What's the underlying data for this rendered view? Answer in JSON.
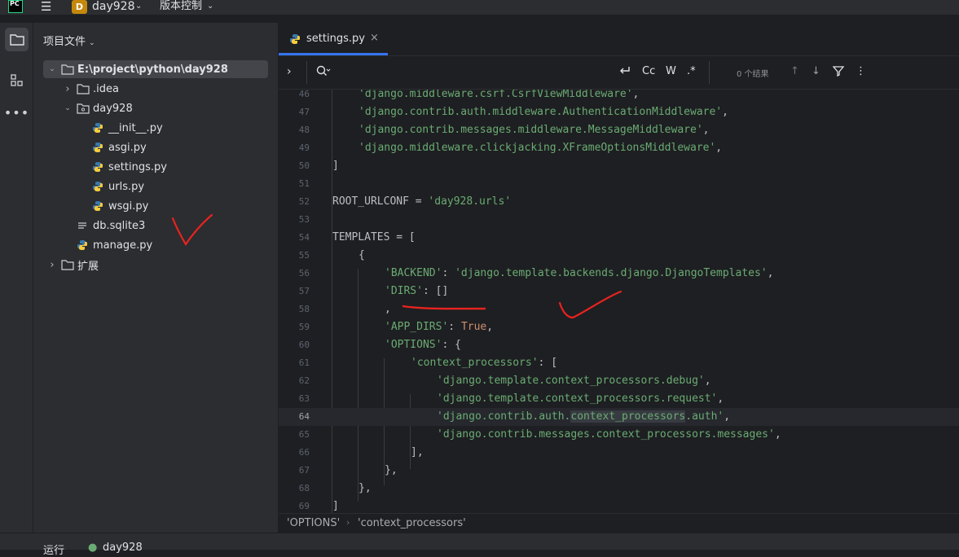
{
  "titlebar": {
    "logo_text": "PC",
    "project_badge": "D",
    "project_name": "day928",
    "vcs_label": "版本控制"
  },
  "project_panel": {
    "title": "项目文件",
    "tree": [
      {
        "label": "E:\\project\\python\\day928",
        "depth": 0,
        "arrow": "open",
        "icon": "folder-icon",
        "selected": true
      },
      {
        "label": ".idea",
        "depth": 1,
        "arrow": "closed",
        "icon": "folder-icon"
      },
      {
        "label": "day928",
        "depth": 1,
        "arrow": "open",
        "icon": "package-folder-icon"
      },
      {
        "label": "__init__.py",
        "depth": 2,
        "arrow": "none",
        "icon": "python-file-icon"
      },
      {
        "label": "asgi.py",
        "depth": 2,
        "arrow": "none",
        "icon": "python-file-icon"
      },
      {
        "label": "settings.py",
        "depth": 2,
        "arrow": "none",
        "icon": "python-file-icon"
      },
      {
        "label": "urls.py",
        "depth": 2,
        "arrow": "none",
        "icon": "python-file-icon"
      },
      {
        "label": "wsgi.py",
        "depth": 2,
        "arrow": "none",
        "icon": "python-file-icon"
      },
      {
        "label": "db.sqlite3",
        "depth": 1,
        "arrow": "none",
        "icon": "text-file-icon"
      },
      {
        "label": "manage.py",
        "depth": 1,
        "arrow": "none",
        "icon": "python-file-icon"
      },
      {
        "label": "扩展",
        "depth": 0,
        "arrow": "closed",
        "icon": "folder-icon"
      }
    ]
  },
  "editor": {
    "tab": {
      "label": "settings.py"
    },
    "find": {
      "results": "0 个结果",
      "case_label": "Cc",
      "word_label": "W",
      "regex_label": ".*"
    },
    "current_line": 64,
    "lines": [
      {
        "num": "46",
        "indent": 8,
        "tokens": [
          {
            "t": "'django.middleware.csrf.CsrfViewMiddleware'",
            "c": "s"
          },
          {
            "t": ",",
            "c": ""
          }
        ]
      },
      {
        "num": "47",
        "indent": 8,
        "tokens": [
          {
            "t": "'django.contrib.auth.middleware.AuthenticationMiddleware'",
            "c": "s"
          },
          {
            "t": ",",
            "c": ""
          }
        ]
      },
      {
        "num": "48",
        "indent": 8,
        "tokens": [
          {
            "t": "'django.contrib.messages.middleware.MessageMiddleware'",
            "c": "s"
          },
          {
            "t": ",",
            "c": ""
          }
        ]
      },
      {
        "num": "49",
        "indent": 8,
        "tokens": [
          {
            "t": "'django.middleware.clickjacking.XFrameOptionsMiddleware'",
            "c": "s"
          },
          {
            "t": ",",
            "c": ""
          }
        ]
      },
      {
        "num": "50",
        "indent": 0,
        "tokens": [
          {
            "t": "]",
            "c": ""
          }
        ]
      },
      {
        "num": "51",
        "indent": 0,
        "tokens": []
      },
      {
        "num": "52",
        "indent": 0,
        "tokens": [
          {
            "t": "ROOT_URLCONF = ",
            "c": ""
          },
          {
            "t": "'day928.urls'",
            "c": "s"
          }
        ]
      },
      {
        "num": "53",
        "indent": 0,
        "tokens": []
      },
      {
        "num": "54",
        "indent": 0,
        "tokens": [
          {
            "t": "TEMPLATES = [",
            "c": ""
          }
        ]
      },
      {
        "num": "55",
        "indent": 8,
        "tokens": [
          {
            "t": "{",
            "c": ""
          }
        ]
      },
      {
        "num": "56",
        "indent": 16,
        "tokens": [
          {
            "t": "'BACKEND'",
            "c": "s"
          },
          {
            "t": ": ",
            "c": ""
          },
          {
            "t": "'django.template.backends.django.DjangoTemplates'",
            "c": "s"
          },
          {
            "t": ",",
            "c": ""
          }
        ]
      },
      {
        "num": "57",
        "indent": 16,
        "tokens": [
          {
            "t": "'DIRS'",
            "c": "s"
          },
          {
            "t": ": []",
            "c": ""
          }
        ]
      },
      {
        "num": "58",
        "indent": 16,
        "tokens": [
          {
            "t": ",",
            "c": ""
          }
        ]
      },
      {
        "num": "59",
        "indent": 16,
        "tokens": [
          {
            "t": "'APP_DIRS'",
            "c": "s"
          },
          {
            "t": ": ",
            "c": ""
          },
          {
            "t": "True",
            "c": "kw"
          },
          {
            "t": ",",
            "c": ""
          }
        ]
      },
      {
        "num": "60",
        "indent": 16,
        "tokens": [
          {
            "t": "'OPTIONS'",
            "c": "s"
          },
          {
            "t": ": {",
            "c": ""
          }
        ]
      },
      {
        "num": "61",
        "indent": 24,
        "tokens": [
          {
            "t": "'context_processors'",
            "c": "s"
          },
          {
            "t": ": [",
            "c": ""
          }
        ]
      },
      {
        "num": "62",
        "indent": 32,
        "tokens": [
          {
            "t": "'django.template.context_processors.debug'",
            "c": "s"
          },
          {
            "t": ",",
            "c": ""
          }
        ]
      },
      {
        "num": "63",
        "indent": 32,
        "tokens": [
          {
            "t": "'django.template.context_processors.request'",
            "c": "s"
          },
          {
            "t": ",",
            "c": ""
          }
        ]
      },
      {
        "num": "64",
        "indent": 32,
        "tokens": [
          {
            "t": "'django.contrib.auth.",
            "c": "s"
          },
          {
            "t": "context_processors",
            "c": "s hl"
          },
          {
            "t": ".auth'",
            "c": "s"
          },
          {
            "t": ",",
            "c": ""
          }
        ]
      },
      {
        "num": "65",
        "indent": 32,
        "tokens": [
          {
            "t": "'django.contrib.messages.context_processors.messages'",
            "c": "s"
          },
          {
            "t": ",",
            "c": ""
          }
        ]
      },
      {
        "num": "66",
        "indent": 24,
        "tokens": [
          {
            "t": "],",
            "c": ""
          }
        ]
      },
      {
        "num": "67",
        "indent": 16,
        "tokens": [
          {
            "t": "},",
            "c": ""
          }
        ]
      },
      {
        "num": "68",
        "indent": 8,
        "tokens": [
          {
            "t": "},",
            "c": ""
          }
        ]
      },
      {
        "num": "69",
        "indent": 0,
        "tokens": [
          {
            "t": "]",
            "c": ""
          }
        ]
      }
    ],
    "breadcrumb": [
      "'OPTIONS'",
      "'context_processors'"
    ]
  },
  "bottom": {
    "run_label": "运行",
    "run_config": "day928"
  },
  "colors": {
    "accent": "#3574f0",
    "string": "#6aab73",
    "keyword": "#cf8e6d",
    "annotation": "#e8231f"
  }
}
